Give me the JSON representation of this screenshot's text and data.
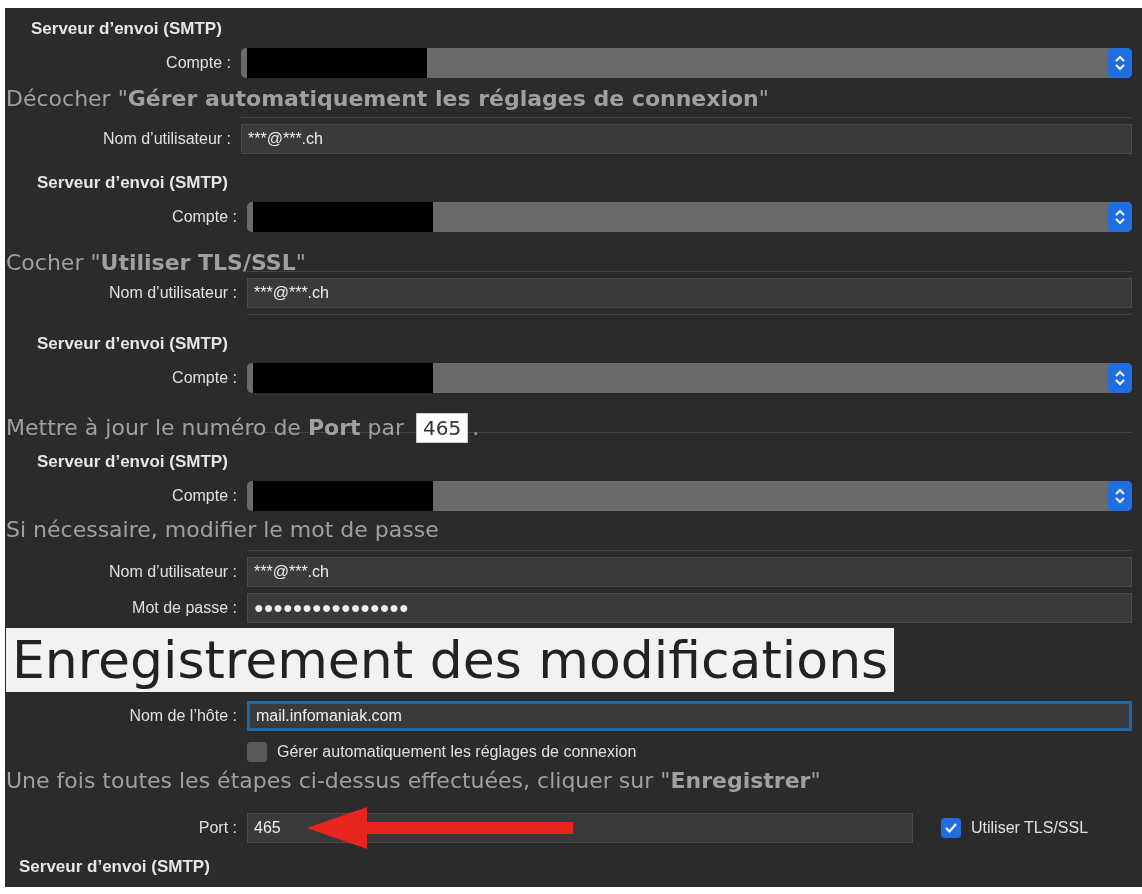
{
  "panels": [
    {
      "heading": "Serveur d’envoi (SMTP)",
      "rows": [
        {
          "kind": "select",
          "label": "Compte :"
        },
        {
          "kind": "separator"
        },
        {
          "kind": "field",
          "label": "Nom d’utilisateur :",
          "value": "***@***.ch",
          "focused": false
        }
      ]
    },
    {
      "heading": "Serveur d’envoi (SMTP)",
      "rows": [
        {
          "kind": "select",
          "label": "Compte :"
        },
        {
          "kind": "separator"
        },
        {
          "kind": "field",
          "label": "Nom d’utilisateur :",
          "value": "***@***.ch",
          "focused": false
        },
        {
          "kind": "separator"
        }
      ]
    },
    {
      "heading": "Serveur d’envoi (SMTP)",
      "rows": [
        {
          "kind": "select",
          "label": "Compte :"
        },
        {
          "kind": "separator"
        }
      ]
    },
    {
      "heading": "Serveur d’envoi (SMTP)",
      "rows": [
        {
          "kind": "select",
          "label": "Compte :"
        },
        {
          "kind": "separator"
        },
        {
          "kind": "field",
          "label": "Nom d’utilisateur :",
          "value": "***@***.ch",
          "focused": false
        },
        {
          "kind": "field",
          "label": "Mot de passe :",
          "value": "●●●●●●●●●●●●●●●●",
          "focused": false
        },
        {
          "kind": "field",
          "label": "Nom de l’hôte :",
          "value": "mail.infomaniak.com",
          "focused": true
        },
        {
          "kind": "checkbox",
          "label": "Gérer automatiquement les réglages de connexion",
          "checked": false
        },
        {
          "kind": "port",
          "label": "Port :",
          "value": "465",
          "option": {
            "label": "Utiliser TLS/SSL",
            "checked": true
          }
        }
      ]
    },
    {
      "heading": "Serveur d’envoi (SMTP)"
    }
  ],
  "overlay": [
    {
      "kind": "step",
      "text": "Décocher \"**Gérer automatiquement les réglages de connexion**\""
    },
    {
      "kind": "step",
      "text": "Cocher \"**Utiliser TLS/SSL**\""
    },
    {
      "kind": "code_step",
      "text": "Mettre à jour le numéro de **Port** par",
      "code": "465",
      "after": "."
    },
    {
      "kind": "step",
      "text": "Si nécessaire, modifier le mot de passe"
    },
    {
      "kind": "title",
      "text": "Enregistrement des modifications"
    },
    {
      "kind": "step",
      "text": "Une fois toutes les étapes ci-dessus effectuées, cliquer sur \"**Enregistrer**\""
    }
  ]
}
